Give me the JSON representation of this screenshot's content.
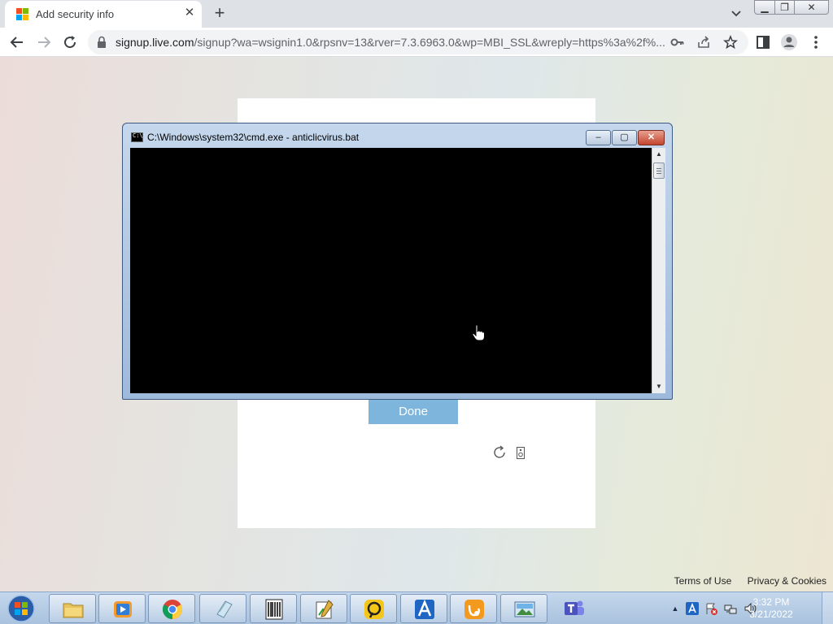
{
  "browser": {
    "tab": {
      "title": "Add security info"
    },
    "new_tab_label": "+",
    "omnibox": {
      "host": "signup.live.com",
      "path": "/signup?wa=wsignin1.0&rpsnv=13&rver=7.3.6963.0&wp=MBI_SSL&wreply=https%3a%2f%..."
    }
  },
  "page": {
    "done_button": "Done",
    "footer": {
      "terms": "Terms of Use",
      "privacy": "Privacy & Cookies"
    }
  },
  "cmd_window": {
    "title": "C:\\Windows\\system32\\cmd.exe - anticlicvirus.bat",
    "icon_text": "C:\\",
    "buttons": {
      "minimize": "–",
      "maximize": "▢",
      "close": "✕"
    }
  },
  "taskbar": {
    "apps": [
      "file-explorer",
      "media-player",
      "chrome",
      "notepad",
      "archive-tool",
      "editor",
      "remote-tool",
      "arc-app",
      "uc-browser",
      "image-viewer",
      "teams"
    ],
    "clock": {
      "time": "3:32 PM",
      "date": "3/21/2022"
    }
  },
  "colors": {
    "accent": "#7db5dd",
    "console": "#000000",
    "close_red": "#c4452f"
  }
}
